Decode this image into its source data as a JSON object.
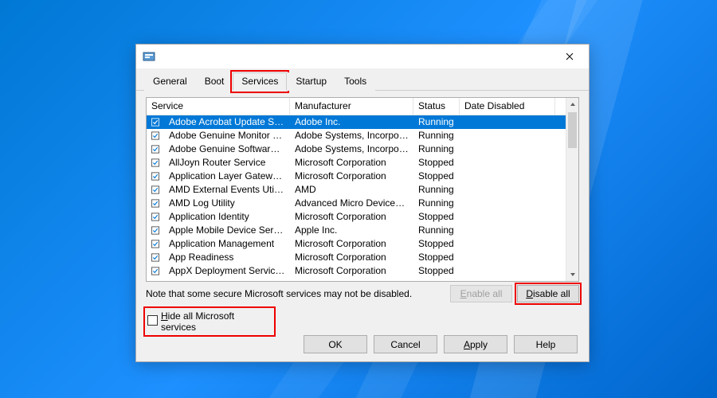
{
  "window": {
    "title": ""
  },
  "tabs": [
    {
      "label": "General"
    },
    {
      "label": "Boot"
    },
    {
      "label": "Services"
    },
    {
      "label": "Startup"
    },
    {
      "label": "Tools"
    }
  ],
  "activeTab": 2,
  "columns": {
    "service": "Service",
    "manufacturer": "Manufacturer",
    "status": "Status",
    "dateDisabled": "Date Disabled"
  },
  "rows": [
    {
      "checked": true,
      "selected": true,
      "service": "Adobe Acrobat Update Service",
      "manufacturer": "Adobe Inc.",
      "status": "Running",
      "date": ""
    },
    {
      "checked": true,
      "service": "Adobe Genuine Monitor Service",
      "manufacturer": "Adobe Systems, Incorpora...",
      "status": "Running",
      "date": ""
    },
    {
      "checked": true,
      "service": "Adobe Genuine Software Integri...",
      "manufacturer": "Adobe Systems, Incorpora...",
      "status": "Running",
      "date": ""
    },
    {
      "checked": true,
      "service": "AllJoyn Router Service",
      "manufacturer": "Microsoft Corporation",
      "status": "Stopped",
      "date": ""
    },
    {
      "checked": true,
      "service": "Application Layer Gateway Service",
      "manufacturer": "Microsoft Corporation",
      "status": "Stopped",
      "date": ""
    },
    {
      "checked": true,
      "service": "AMD External Events Utility",
      "manufacturer": "AMD",
      "status": "Running",
      "date": ""
    },
    {
      "checked": true,
      "service": "AMD Log Utility",
      "manufacturer": "Advanced Micro Devices, I...",
      "status": "Running",
      "date": ""
    },
    {
      "checked": true,
      "service": "Application Identity",
      "manufacturer": "Microsoft Corporation",
      "status": "Stopped",
      "date": ""
    },
    {
      "checked": true,
      "service": "Apple Mobile Device Service",
      "manufacturer": "Apple Inc.",
      "status": "Running",
      "date": ""
    },
    {
      "checked": true,
      "service": "Application Management",
      "manufacturer": "Microsoft Corporation",
      "status": "Stopped",
      "date": ""
    },
    {
      "checked": true,
      "service": "App Readiness",
      "manufacturer": "Microsoft Corporation",
      "status": "Stopped",
      "date": ""
    },
    {
      "checked": true,
      "service": "AppX Deployment Service (AppX...",
      "manufacturer": "Microsoft Corporation",
      "status": "Stopped",
      "date": ""
    }
  ],
  "note": "Note that some secure Microsoft services may not be disabled.",
  "buttons": {
    "enableAll": "Enable all",
    "disableAll": "Disable all",
    "ok": "OK",
    "cancel": "Cancel",
    "apply": "Apply",
    "help": "Help"
  },
  "hideMs": {
    "label": "Hide all Microsoft services",
    "checked": false
  }
}
